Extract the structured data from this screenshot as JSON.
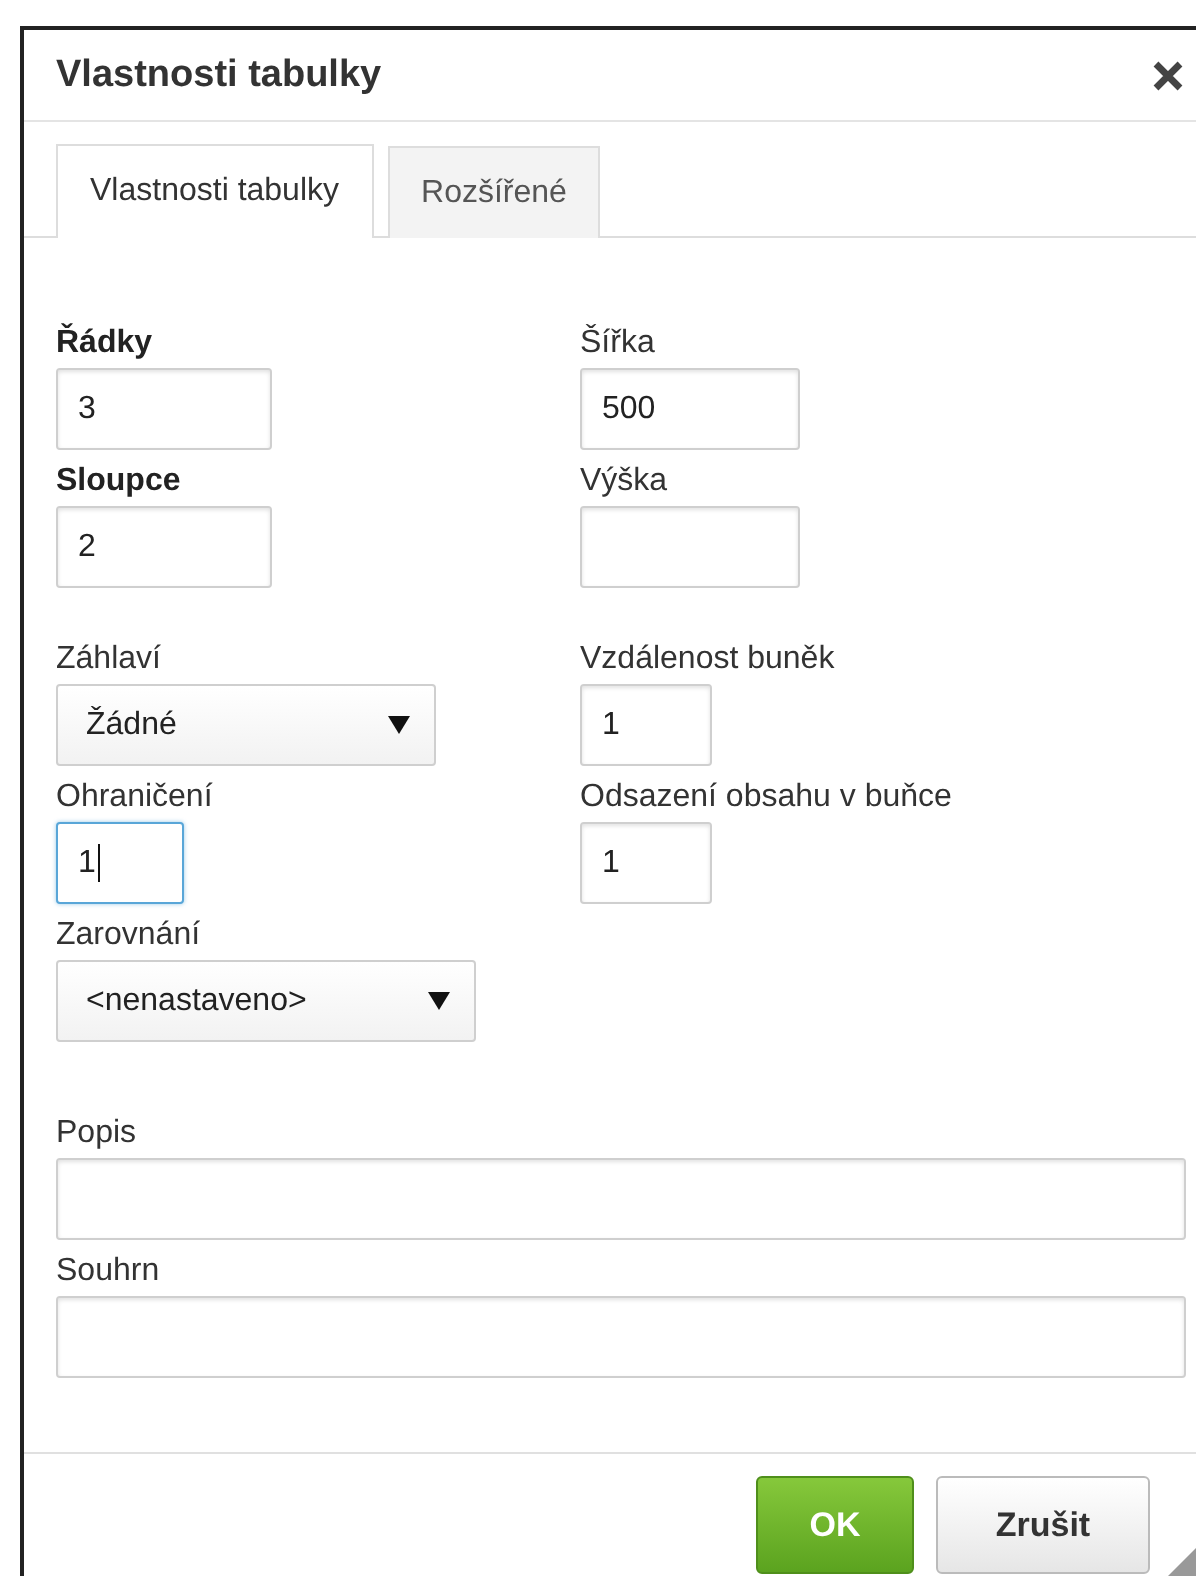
{
  "window": {
    "title": "Vlastnosti tabulky"
  },
  "tabs": [
    {
      "label": "Vlastnosti tabulky",
      "selected": true
    },
    {
      "label": "Rozšířené",
      "selected": false
    }
  ],
  "sections": [
    {
      "columns": [
        [
          {
            "kind": "text",
            "label": "Řádky",
            "required": true,
            "value": "3",
            "focused": false
          },
          {
            "kind": "text",
            "label": "Sloupce",
            "required": true,
            "value": "2",
            "focused": false
          }
        ],
        [
          {
            "kind": "text",
            "label": "Šířka",
            "required": false,
            "value": "500",
            "focused": false
          },
          {
            "kind": "text",
            "label": "Výška",
            "required": false,
            "focused": false
          }
        ]
      ]
    },
    {
      "columns": [
        [
          {
            "kind": "select",
            "label": "Záhlaví",
            "required": false,
            "value": "Žádné",
            "focused": false
          },
          {
            "kind": "text",
            "label": "Ohraničení",
            "required": false,
            "value": "1",
            "focused": true
          },
          {
            "kind": "select",
            "label": "Zarovnání",
            "required": false,
            "value": "<nenastaveno>",
            "focused": false
          }
        ],
        [
          {
            "kind": "text",
            "label": "Vzdálenost buněk",
            "required": false,
            "value": "1",
            "focused": false
          },
          {
            "kind": "text",
            "label": "Odsazení obsahu v buňce",
            "required": false,
            "value": "1",
            "focused": false
          }
        ]
      ]
    }
  ],
  "wide_fields": [
    {
      "kind": "text",
      "label": "Popis",
      "required": false,
      "focused": false
    },
    {
      "kind": "text",
      "label": "Souhrn",
      "required": false,
      "focused": false
    }
  ],
  "buttons": [
    {
      "label": "OK",
      "kind": "primary"
    },
    {
      "label": "Zrušit",
      "kind": "secondary"
    }
  ]
}
